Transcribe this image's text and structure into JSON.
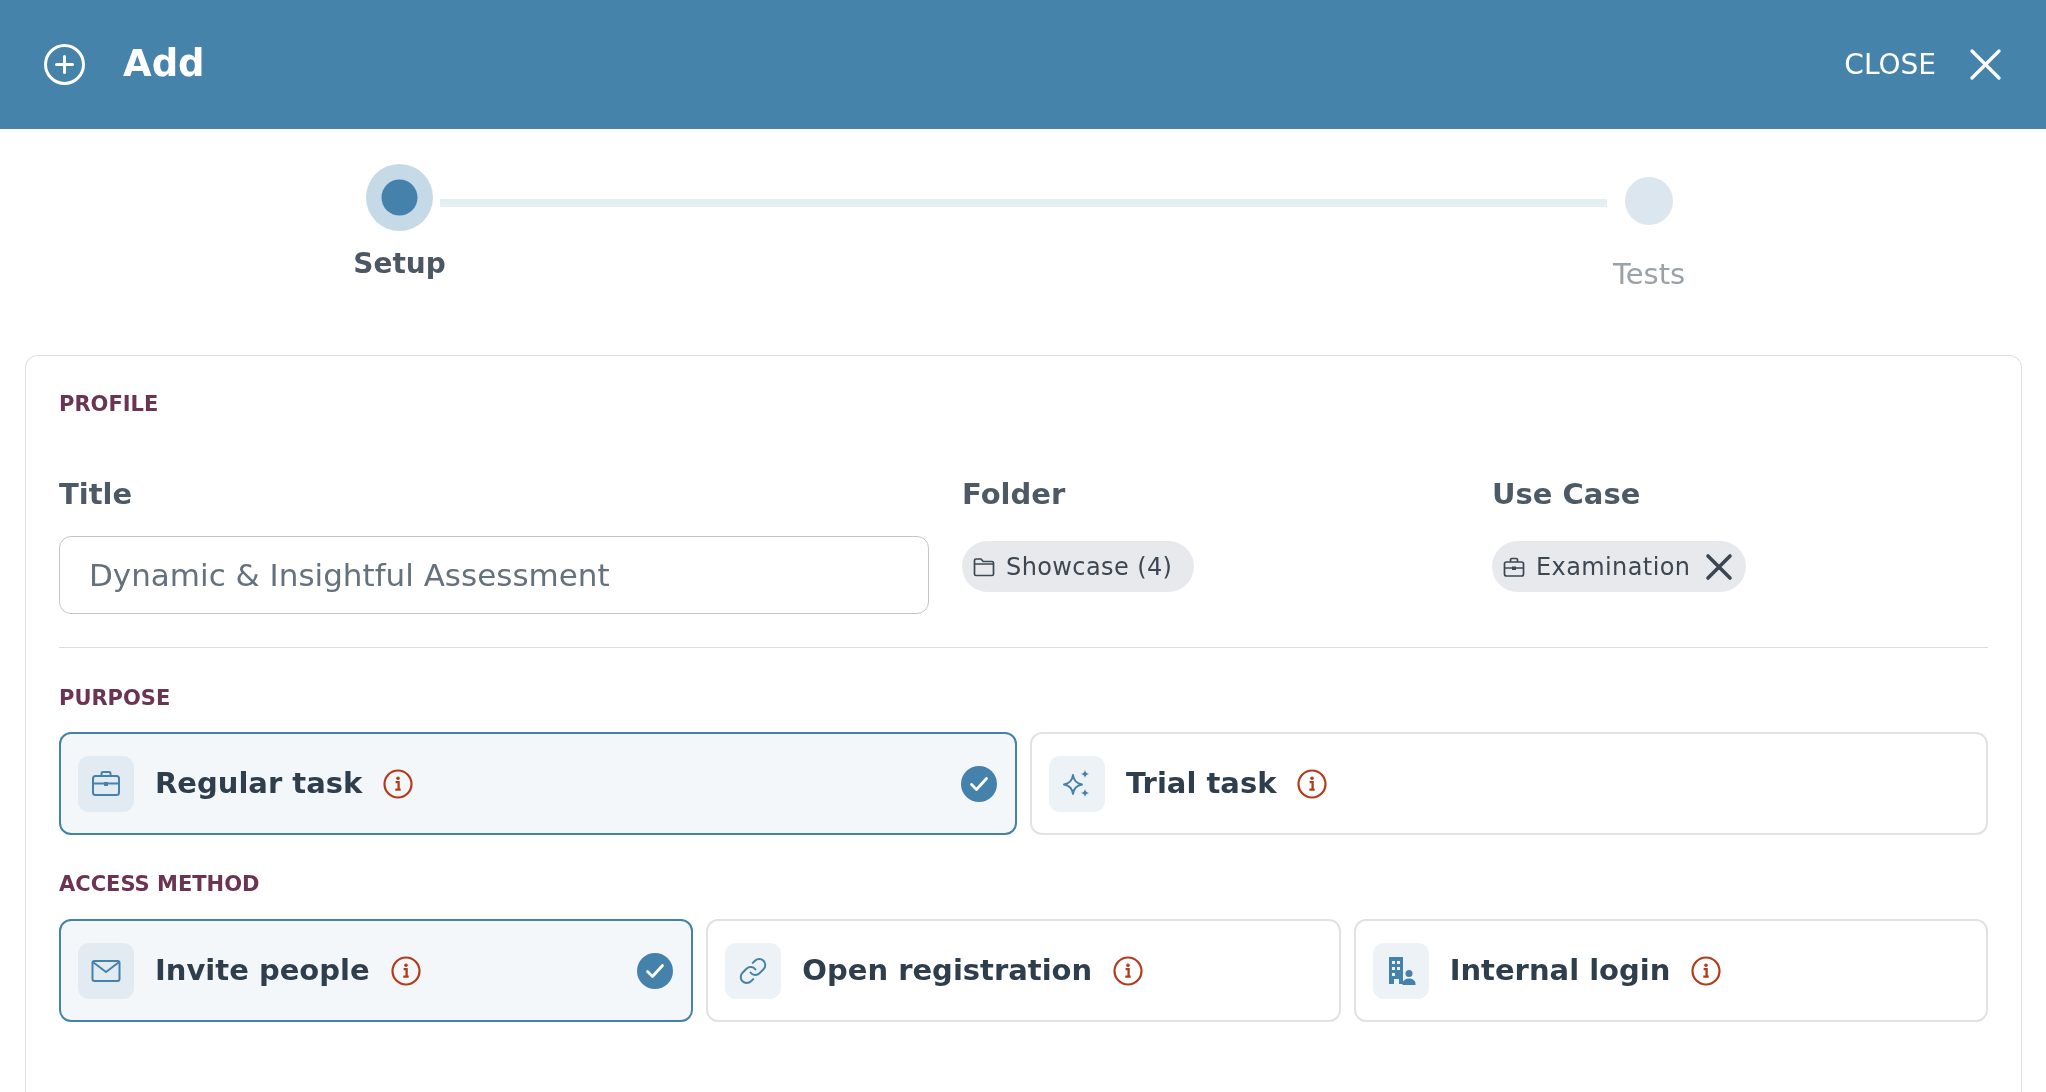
{
  "dialog": {
    "title": "Add",
    "close_label": "CLOSE"
  },
  "steps": [
    {
      "label": "Setup",
      "selected": true
    },
    {
      "label": "Tests",
      "selected": false
    }
  ],
  "profile": {
    "heading": "PROFILE",
    "title": {
      "label": "Title",
      "value": "Dynamic & Insightful Assessment"
    },
    "folder": {
      "label": "Folder",
      "value": "Showcase (4)"
    },
    "use_case": {
      "label": "Use Case",
      "value": "Examination"
    }
  },
  "purpose": {
    "heading": "PURPOSE",
    "options": [
      {
        "label": "Regular task",
        "selected": true
      },
      {
        "label": "Trial task",
        "selected": false
      }
    ]
  },
  "access_method": {
    "heading": "ACCESS METHOD",
    "options": [
      {
        "label": "Invite people",
        "selected": true
      },
      {
        "label": "Open registration",
        "selected": false
      },
      {
        "label": "Internal login",
        "selected": false
      }
    ]
  }
}
